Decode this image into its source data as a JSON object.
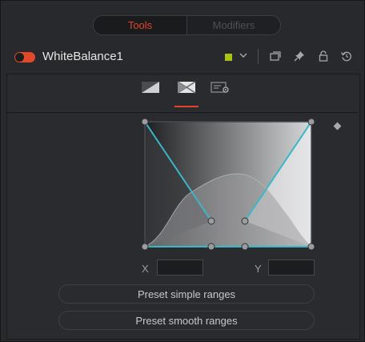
{
  "tabs": {
    "tools_label": "Tools",
    "modifiers_label": "Modifiers"
  },
  "node": {
    "name": "WhiteBalance1",
    "color_chip": "#a9c214",
    "enabled": true
  },
  "header_icons": [
    "color-dropdown-chevron-icon",
    "versions-icon",
    "pin-icon",
    "lock-icon",
    "reset-icon"
  ],
  "inspector_tabs": [
    {
      "icon": "color-tab-icon",
      "active": false
    },
    {
      "icon": "ranges-tab-icon",
      "active": true
    },
    {
      "icon": "settings-tab-icon",
      "active": false
    }
  ],
  "range_editor": {
    "x_label": "X",
    "x_value": "",
    "y_label": "Y",
    "y_value": ""
  },
  "buttons": {
    "preset_simple": "Preset simple ranges",
    "preset_smooth": "Preset smooth ranges"
  },
  "colors": {
    "accent": "#e2452c",
    "curve": "#3ab7c9"
  }
}
